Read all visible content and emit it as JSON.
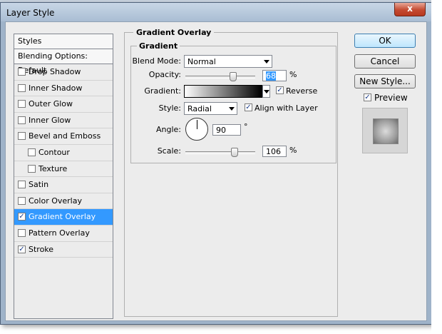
{
  "window": {
    "title": "Layer Style",
    "close_label": "x"
  },
  "styles_list": {
    "header": "Styles",
    "blending": "Blending Options: Default",
    "items": [
      {
        "label": "Drop Shadow",
        "checked": false,
        "sub": false,
        "selected": false
      },
      {
        "label": "Inner Shadow",
        "checked": false,
        "sub": false,
        "selected": false
      },
      {
        "label": "Outer Glow",
        "checked": false,
        "sub": false,
        "selected": false
      },
      {
        "label": "Inner Glow",
        "checked": false,
        "sub": false,
        "selected": false
      },
      {
        "label": "Bevel and Emboss",
        "checked": false,
        "sub": false,
        "selected": false
      },
      {
        "label": "Contour",
        "checked": false,
        "sub": true,
        "selected": false
      },
      {
        "label": "Texture",
        "checked": false,
        "sub": true,
        "selected": false
      },
      {
        "label": "Satin",
        "checked": false,
        "sub": false,
        "selected": false
      },
      {
        "label": "Color Overlay",
        "checked": false,
        "sub": false,
        "selected": false
      },
      {
        "label": "Gradient Overlay",
        "checked": true,
        "sub": false,
        "selected": true
      },
      {
        "label": "Pattern Overlay",
        "checked": false,
        "sub": false,
        "selected": false
      },
      {
        "label": "Stroke",
        "checked": true,
        "sub": false,
        "selected": false
      }
    ]
  },
  "panel": {
    "outer_title": "Gradient Overlay",
    "inner_title": "Gradient",
    "blend_mode": {
      "label": "Blend Mode:",
      "value": "Normal"
    },
    "opacity": {
      "label": "Opacity:",
      "value": "68",
      "unit": "%",
      "level": 68
    },
    "gradient": {
      "label": "Gradient:",
      "reverse_label": "Reverse",
      "reverse_checked": true
    },
    "style": {
      "label": "Style:",
      "value": "Radial",
      "align_label": "Align with Layer",
      "align_checked": true
    },
    "angle": {
      "label": "Angle:",
      "value": "90",
      "unit": "°"
    },
    "scale": {
      "label": "Scale:",
      "value": "106",
      "unit": "%",
      "level": 106
    }
  },
  "buttons": {
    "ok": "OK",
    "cancel": "Cancel",
    "new_style": "New Style...",
    "preview_label": "Preview",
    "preview_checked": true
  }
}
